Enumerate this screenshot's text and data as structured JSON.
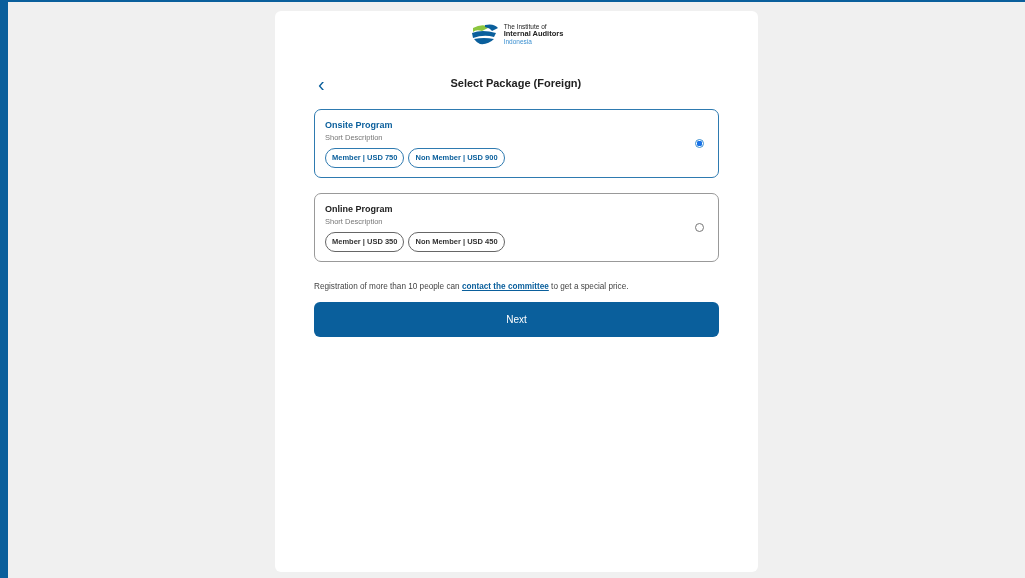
{
  "logo": {
    "lines": [
      "The Institute of",
      "Internal Auditors",
      "Indonesia"
    ]
  },
  "header": {
    "back": "‹",
    "title": "Select Package (Foreign)"
  },
  "packages": [
    {
      "name": "Onsite Program",
      "description": "Short Description",
      "selected": true,
      "prices": [
        "Member | USD 750",
        "Non Member | USD 900"
      ]
    },
    {
      "name": "Online Program",
      "description": "Short Description",
      "selected": false,
      "prices": [
        "Member | USD 350",
        "Non Member | USD 450"
      ]
    }
  ],
  "note": {
    "before": "Registration of more than 10 people can ",
    "link": "contact the committee",
    "after": " to get a special price."
  },
  "button": "Next"
}
